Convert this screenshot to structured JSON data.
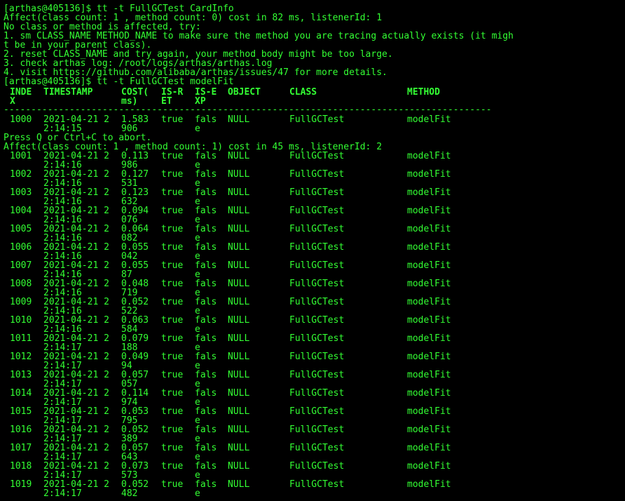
{
  "terminal": {
    "lines_top": [
      "[arthas@405136]$ tt -t FullGCTest CardInfo",
      "Affect(class count: 1 , method count: 0) cost in 82 ms, listenerId: 1",
      "No class or method is affected, try:",
      "1. sm CLASS_NAME METHOD_NAME to make sure the method you are tracing actually exists (it migh",
      "t be in your parent class).",
      "2. reset CLASS_NAME and try again, your method body might be too large.",
      "3. check arthas log: /root/logs/arthas/arthas.log",
      "4. visit https://github.com/alibaba/arthas/issues/47 for more details.",
      "[arthas@405136]$ tt -t FullGCTest modelFit"
    ],
    "header": {
      "index": [
        "INDE",
        "X"
      ],
      "timestamp": [
        "TIMESTAMP",
        ""
      ],
      "cost": [
        "COST(",
        "ms)"
      ],
      "is_ret": [
        "IS-R",
        "ET"
      ],
      "is_exp": [
        "IS-E",
        "XP"
      ],
      "object": [
        "OBJECT",
        ""
      ],
      "class": [
        "CLASS",
        ""
      ],
      "method": [
        "METHOD",
        ""
      ]
    },
    "divider": "-----------------------------------------------------------------------------------------",
    "first_row": {
      "index": "1000",
      "ts1": "2021-04-21 2",
      "ts2": "2:14:15",
      "cost1": "1.583",
      "cost2": "906",
      "ret": "true",
      "exp1": "fals",
      "exp2": "e",
      "object": "NULL",
      "class": "FullGCTest",
      "method": "modelFit"
    },
    "press_line": "Press Q or Ctrl+C to abort.",
    "affect_line": "Affect(class count: 1 , method count: 1) cost in 45 ms, listenerId: 2",
    "rows": [
      {
        "index": "1001",
        "ts1": "2021-04-21 2",
        "ts2": "2:14:16",
        "cost1": "0.113",
        "cost2": "986",
        "ret": "true",
        "exp1": "fals",
        "exp2": "e",
        "object": "NULL",
        "class": "FullGCTest",
        "method": "modelFit"
      },
      {
        "index": "1002",
        "ts1": "2021-04-21 2",
        "ts2": "2:14:16",
        "cost1": "0.127",
        "cost2": "531",
        "ret": "true",
        "exp1": "fals",
        "exp2": "e",
        "object": "NULL",
        "class": "FullGCTest",
        "method": "modelFit"
      },
      {
        "index": "1003",
        "ts1": "2021-04-21 2",
        "ts2": "2:14:16",
        "cost1": "0.123",
        "cost2": "632",
        "ret": "true",
        "exp1": "fals",
        "exp2": "e",
        "object": "NULL",
        "class": "FullGCTest",
        "method": "modelFit"
      },
      {
        "index": "1004",
        "ts1": "2021-04-21 2",
        "ts2": "2:14:16",
        "cost1": "0.094",
        "cost2": "076",
        "ret": "true",
        "exp1": "fals",
        "exp2": "e",
        "object": "NULL",
        "class": "FullGCTest",
        "method": "modelFit"
      },
      {
        "index": "1005",
        "ts1": "2021-04-21 2",
        "ts2": "2:14:16",
        "cost1": "0.064",
        "cost2": "082",
        "ret": "true",
        "exp1": "fals",
        "exp2": "e",
        "object": "NULL",
        "class": "FullGCTest",
        "method": "modelFit"
      },
      {
        "index": "1006",
        "ts1": "2021-04-21 2",
        "ts2": "2:14:16",
        "cost1": "0.055",
        "cost2": "042",
        "ret": "true",
        "exp1": "fals",
        "exp2": "e",
        "object": "NULL",
        "class": "FullGCTest",
        "method": "modelFit"
      },
      {
        "index": "1007",
        "ts1": "2021-04-21 2",
        "ts2": "2:14:16",
        "cost1": "0.055",
        "cost2": "87",
        "ret": "true",
        "exp1": "fals",
        "exp2": "e",
        "object": "NULL",
        "class": "FullGCTest",
        "method": "modelFit"
      },
      {
        "index": "1008",
        "ts1": "2021-04-21 2",
        "ts2": "2:14:16",
        "cost1": "0.048",
        "cost2": "719",
        "ret": "true",
        "exp1": "fals",
        "exp2": "e",
        "object": "NULL",
        "class": "FullGCTest",
        "method": "modelFit"
      },
      {
        "index": "1009",
        "ts1": "2021-04-21 2",
        "ts2": "2:14:16",
        "cost1": "0.052",
        "cost2": "522",
        "ret": "true",
        "exp1": "fals",
        "exp2": "e",
        "object": "NULL",
        "class": "FullGCTest",
        "method": "modelFit"
      },
      {
        "index": "1010",
        "ts1": "2021-04-21 2",
        "ts2": "2:14:16",
        "cost1": "0.063",
        "cost2": "584",
        "ret": "true",
        "exp1": "fals",
        "exp2": "e",
        "object": "NULL",
        "class": "FullGCTest",
        "method": "modelFit"
      },
      {
        "index": "1011",
        "ts1": "2021-04-21 2",
        "ts2": "2:14:17",
        "cost1": "0.079",
        "cost2": "188",
        "ret": "true",
        "exp1": "fals",
        "exp2": "e",
        "object": "NULL",
        "class": "FullGCTest",
        "method": "modelFit"
      },
      {
        "index": "1012",
        "ts1": "2021-04-21 2",
        "ts2": "2:14:17",
        "cost1": "0.049",
        "cost2": "94",
        "ret": "true",
        "exp1": "fals",
        "exp2": "e",
        "object": "NULL",
        "class": "FullGCTest",
        "method": "modelFit"
      },
      {
        "index": "1013",
        "ts1": "2021-04-21 2",
        "ts2": "2:14:17",
        "cost1": "0.057",
        "cost2": "057",
        "ret": "true",
        "exp1": "fals",
        "exp2": "e",
        "object": "NULL",
        "class": "FullGCTest",
        "method": "modelFit"
      },
      {
        "index": "1014",
        "ts1": "2021-04-21 2",
        "ts2": "2:14:17",
        "cost1": "0.114",
        "cost2": "974",
        "ret": "true",
        "exp1": "fals",
        "exp2": "e",
        "object": "NULL",
        "class": "FullGCTest",
        "method": "modelFit"
      },
      {
        "index": "1015",
        "ts1": "2021-04-21 2",
        "ts2": "2:14:17",
        "cost1": "0.053",
        "cost2": "795",
        "ret": "true",
        "exp1": "fals",
        "exp2": "e",
        "object": "NULL",
        "class": "FullGCTest",
        "method": "modelFit"
      },
      {
        "index": "1016",
        "ts1": "2021-04-21 2",
        "ts2": "2:14:17",
        "cost1": "0.052",
        "cost2": "389",
        "ret": "true",
        "exp1": "fals",
        "exp2": "e",
        "object": "NULL",
        "class": "FullGCTest",
        "method": "modelFit"
      },
      {
        "index": "1017",
        "ts1": "2021-04-21 2",
        "ts2": "2:14:17",
        "cost1": "0.057",
        "cost2": "643",
        "ret": "true",
        "exp1": "fals",
        "exp2": "e",
        "object": "NULL",
        "class": "FullGCTest",
        "method": "modelFit"
      },
      {
        "index": "1018",
        "ts1": "2021-04-21 2",
        "ts2": "2:14:17",
        "cost1": "0.073",
        "cost2": "573",
        "ret": "true",
        "exp1": "fals",
        "exp2": "e",
        "object": "NULL",
        "class": "FullGCTest",
        "method": "modelFit"
      },
      {
        "index": "1019",
        "ts1": "2021-04-21 2",
        "ts2": "2:14:17",
        "cost1": "0.052",
        "cost2": "482",
        "ret": "true",
        "exp1": "fals",
        "exp2": "e",
        "object": "NULL",
        "class": "FullGCTest",
        "method": "modelFit"
      }
    ]
  },
  "colors": {
    "background": "#000000",
    "text": "#33ff33"
  }
}
